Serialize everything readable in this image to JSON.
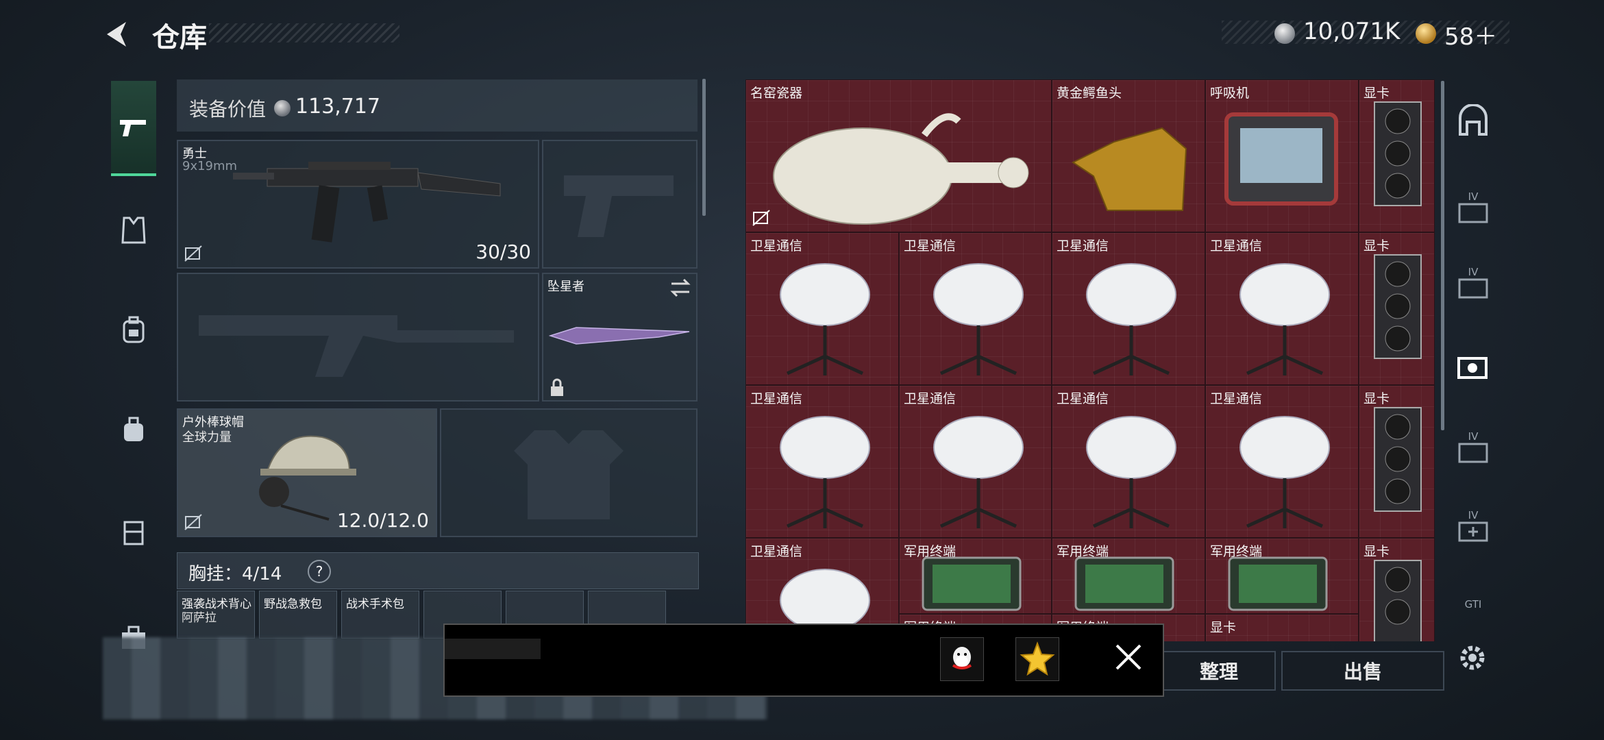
{
  "header": {
    "title": "仓库",
    "silver_amount": "10,071K",
    "gold_amount": "58＋"
  },
  "equipment": {
    "value_label": "装备价值",
    "value": "113,717",
    "primary_weapon": {
      "name": "勇士",
      "ammo": "9x19mm",
      "count": "30/30"
    },
    "melee": {
      "name": "坠星者"
    },
    "helmet": {
      "name": "户外棒球帽",
      "sub": "全球力量",
      "durability": "12.0/12.0"
    },
    "chest_label": "胸挂：4/14",
    "chest_help": "?",
    "chest_items": [
      {
        "name": "强袭战术背心",
        "sub": "阿萨拉"
      },
      {
        "name": "野战急救包"
      },
      {
        "name": "战术手术包"
      }
    ]
  },
  "stash": {
    "items": [
      "名窑瓷器",
      "黄金鳄鱼头",
      "呼吸机",
      "显卡",
      "卫星通信",
      "卫星通信",
      "卫星通信",
      "卫星通信",
      "显卡",
      "卫星通信",
      "卫星通信",
      "卫星通信",
      "卫星通信",
      "显卡",
      "卫星通信",
      "军用终端",
      "军用终端",
      "军用终端",
      "显卡",
      "军用终端",
      "军用终端",
      "显卡"
    ]
  },
  "right_nav": [
    "IV",
    "IV",
    "IV",
    "IV",
    "GTI"
  ],
  "buttons": {
    "organize": "整理",
    "sell": "出售"
  },
  "colors": {
    "accent_green": "#4fd79a",
    "stash_red": "#5a1f28",
    "panel": "#28323c"
  }
}
